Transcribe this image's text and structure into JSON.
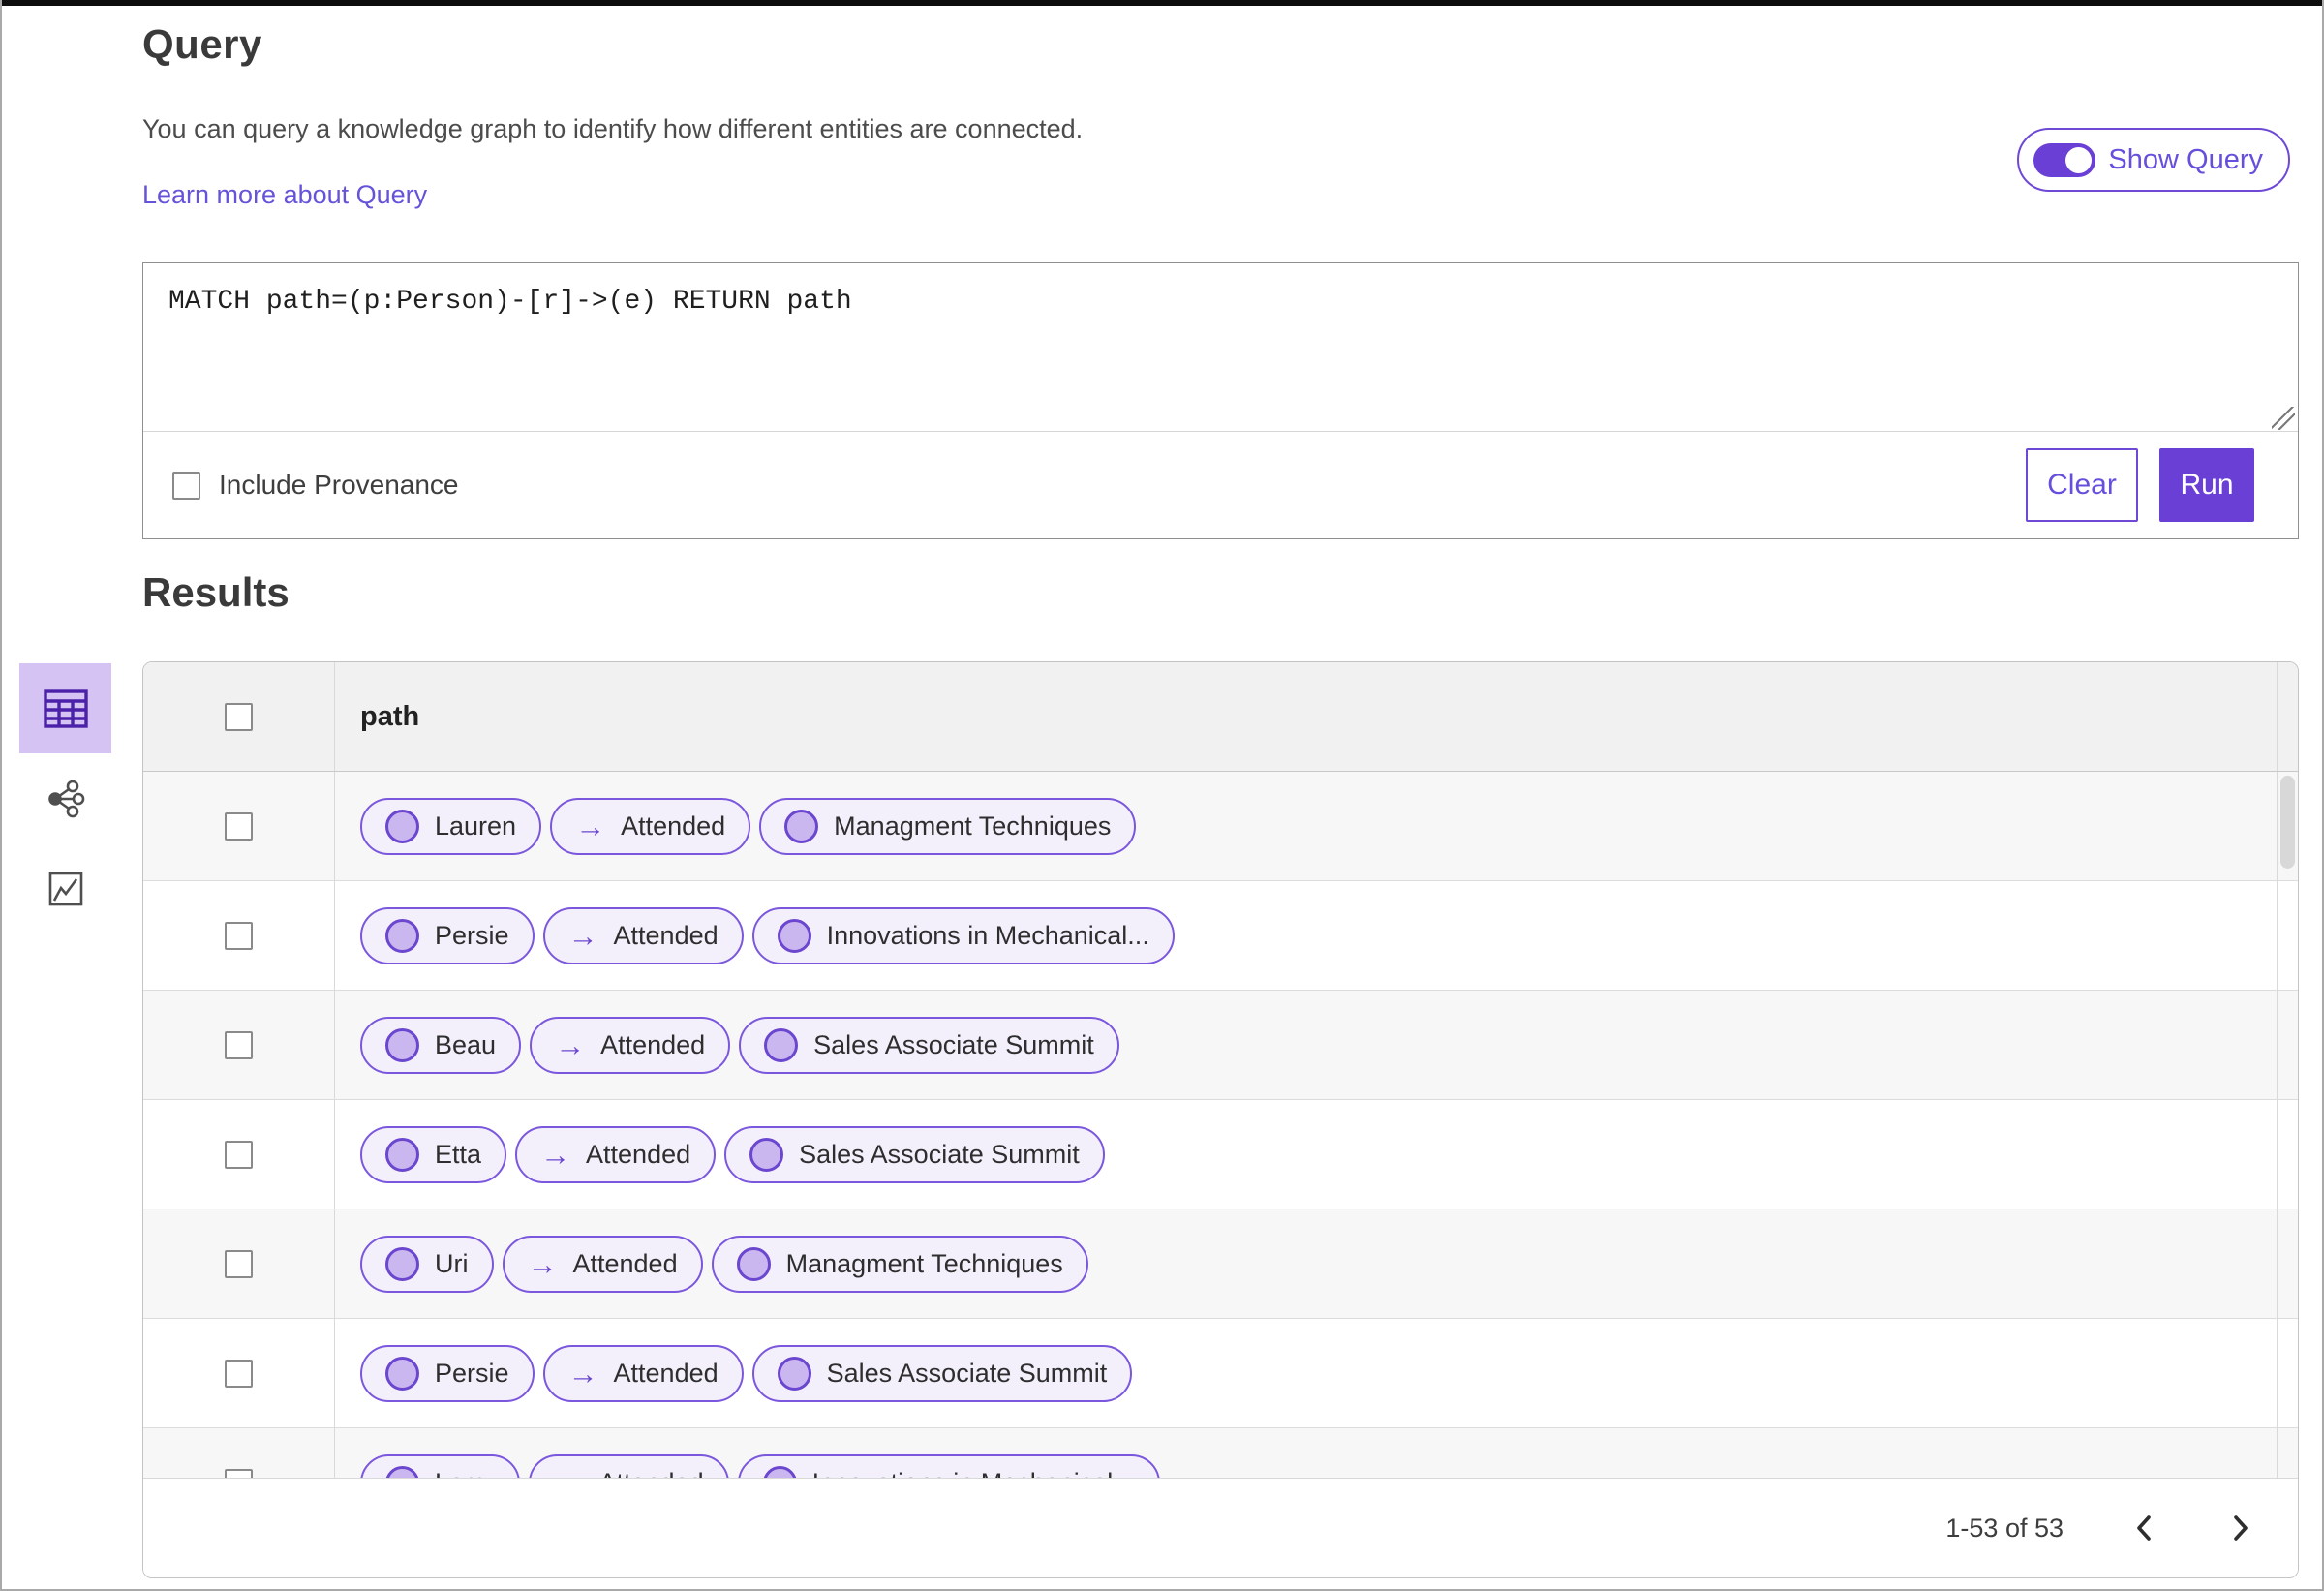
{
  "query": {
    "title": "Query",
    "description": "You can query a knowledge graph to identify how different entities are connected.",
    "learn_more_link": "Learn more about Query",
    "show_query_toggle": {
      "label": "Show Query",
      "state": "on"
    },
    "editor_text": "MATCH path=(p:Person)-[r]->(e) RETURN path",
    "include_provenance": {
      "label": "Include Provenance",
      "checked": false
    },
    "buttons": {
      "clear": "Clear",
      "run": "Run"
    }
  },
  "results": {
    "title": "Results",
    "view_switcher": [
      {
        "name": "table-view",
        "active": true
      },
      {
        "name": "graph-view",
        "active": false
      },
      {
        "name": "chart-view",
        "active": false
      }
    ],
    "table": {
      "column_header": "path",
      "rows": [
        {
          "source": "Lauren",
          "relation": "Attended",
          "target": "Managment Techniques"
        },
        {
          "source": "Persie",
          "relation": "Attended",
          "target": "Innovations in Mechanical..."
        },
        {
          "source": "Beau",
          "relation": "Attended",
          "target": "Sales Associate Summit"
        },
        {
          "source": "Etta",
          "relation": "Attended",
          "target": "Sales Associate Summit"
        },
        {
          "source": "Uri",
          "relation": "Attended",
          "target": "Managment Techniques"
        },
        {
          "source": "Persie",
          "relation": "Attended",
          "target": "Sales Associate Summit"
        },
        {
          "source": "Larry",
          "relation": "Attended",
          "target": "Innovations in Mechanical..."
        }
      ]
    },
    "pagination": {
      "range": "1-53 of 53"
    }
  },
  "icons": {
    "relation_arrow": "→"
  },
  "colors": {
    "accent": "#6a3fd6",
    "pill_border": "#7b57dd",
    "pill_bg": "#f3f0fc",
    "node_fill": "#cab7ef",
    "node_stroke": "#6b46cf",
    "active_tile_bg": "#d5c3f3",
    "link": "#6553d9"
  }
}
